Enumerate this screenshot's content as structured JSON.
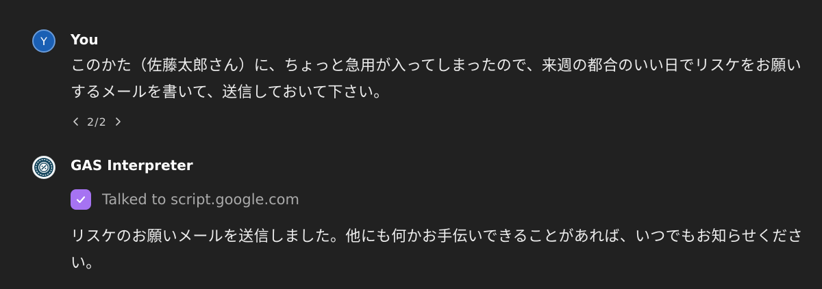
{
  "user_message": {
    "avatar_letter": "Y",
    "author": "You",
    "text": "このかた（佐藤太郎さん）に、ちょっと急用が入ってしまったので、来週の都合のいい日でリスケをお願いするメールを書いて、送信しておいて下さい。",
    "pager": "2/2"
  },
  "assistant_message": {
    "author": "GAS Interpreter",
    "tool_status": "Talked to script.google.com",
    "text": "リスケのお願いメールを送信しました。他にも何かお手伝いできることがあれば、いつでもお知らせください。"
  },
  "colors": {
    "background": "#212121",
    "user_avatar": "#1a5fb4",
    "check_badge": "#a673f2",
    "muted_text": "#a9a9a9"
  },
  "icons": {
    "user_avatar": "letter-avatar",
    "assistant_avatar": "gpt-logo-icon",
    "pager_prev": "chevron-left-icon",
    "pager_next": "chevron-right-icon",
    "tool_status": "check-icon"
  }
}
